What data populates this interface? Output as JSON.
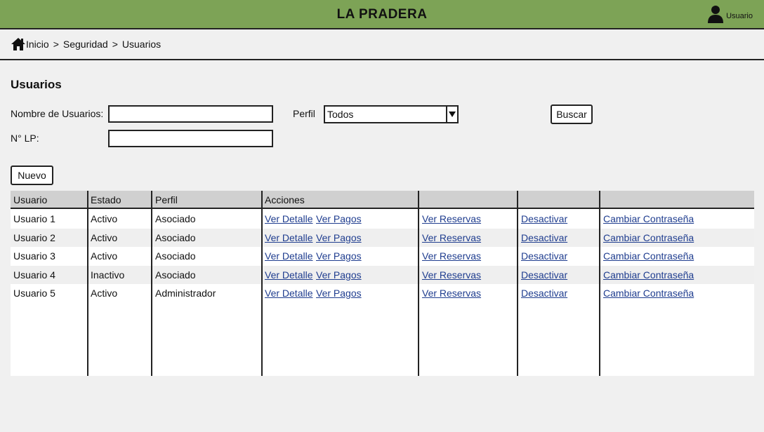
{
  "header": {
    "title": "LA PRADERA",
    "user_label": "Usuario"
  },
  "breadcrumb": {
    "items": [
      "Inicio",
      "Seguridad",
      "Usuarios"
    ],
    "separator": ">"
  },
  "page": {
    "title": "Usuarios"
  },
  "filters": {
    "name_label": "Nombre de Usuarios:",
    "name_value": "",
    "lp_label": "N° LP:",
    "lp_value": "",
    "profile_label": "Perfil",
    "profile_selected": "Todos",
    "search_label": "Buscar"
  },
  "actions": {
    "new_label": "Nuevo"
  },
  "table": {
    "columns": [
      "Usuario",
      "Estado",
      "Perfil",
      "Acciones",
      "",
      "",
      ""
    ],
    "rows": [
      {
        "usuario": "Usuario 1",
        "estado": "Activo",
        "perfil": "Asociado",
        "detalle": "Ver Detalle",
        "pagos": "Ver Pagos",
        "reservas": "Ver Reservas",
        "desactivar": "Desactivar",
        "contrasena": "Cambiar Contraseña"
      },
      {
        "usuario": "Usuario 2",
        "estado": "Activo",
        "perfil": "Asociado",
        "detalle": "Ver Detalle",
        "pagos": "Ver Pagos",
        "reservas": "Ver Reservas",
        "desactivar": "Desactivar",
        "contrasena": "Cambiar Contraseña"
      },
      {
        "usuario": "Usuario 3",
        "estado": "Activo",
        "perfil": "Asociado",
        "detalle": "Ver Detalle",
        "pagos": "Ver Pagos",
        "reservas": "Ver Reservas",
        "desactivar": "Desactivar",
        "contrasena": "Cambiar Contraseña"
      },
      {
        "usuario": "Usuario 4",
        "estado": "Inactivo",
        "perfil": "Asociado",
        "detalle": "Ver Detalle",
        "pagos": "Ver Pagos",
        "reservas": "Ver Reservas",
        "desactivar": "Desactivar",
        "contrasena": "Cambiar Contraseña"
      },
      {
        "usuario": "Usuario 5",
        "estado": "Activo",
        "perfil": "Administrador",
        "detalle": "Ver Detalle",
        "pagos": "Ver Pagos",
        "reservas": "Ver Reservas",
        "desactivar": "Desactivar",
        "contrasena": "Cambiar Contraseña"
      }
    ]
  },
  "icons": {
    "home": "home-icon",
    "user": "user-icon",
    "dropdown": "chevron-down-icon"
  },
  "colors": {
    "header_bg": "#7da356",
    "link": "#1f3d8f",
    "table_header_bg": "#d0d0d0"
  }
}
